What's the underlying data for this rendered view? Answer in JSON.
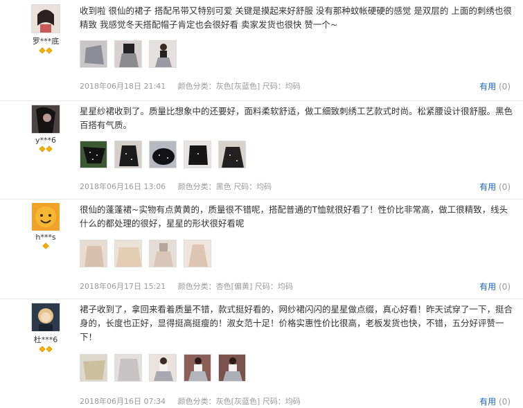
{
  "reviews": [
    {
      "user": "罗***底",
      "text": "收到啦 很仙的裙子 搭配吊带又特别可爱 关键是摸起来好舒服 没有那种蚊帐硬硬的感觉 是双层的 上面的刺绣也很精致 我感觉冬天搭配帽子肯定也会很好看 卖家发货也很快 赞一个~",
      "date": "2018年06月18日 21:41",
      "color_label": "颜色分类：",
      "color": "灰色[灰蓝色]",
      "size_label": "尺码：",
      "size": "均码",
      "useful_label": "有用",
      "useful_count": "(0)"
    },
    {
      "user": "y***6",
      "text": "星星纱裙收到了。质量比想象中的还要好，面料柔软舒适，做工细致刺绣工艺款式时尚。松紧腰设计很舒服。黑色百搭有气质。",
      "date": "2018年06月16日 13:06",
      "color_label": "颜色分类：",
      "color": "黑色",
      "size_label": "尺码：",
      "size": "均码",
      "useful_label": "有用",
      "useful_count": "(0)"
    },
    {
      "user": "h***s",
      "text": "很仙的蓬蓬裙~实物有点黄黄的，质量很不错呢，搭配普通的T恤就很好看了！性价比非常高，做工很精致，线头什么的都处理的很好，星星的形状很好看呢",
      "date": "2018年06月17日 15:21",
      "color_label": "颜色分类：",
      "color": "杏色[偏黄]",
      "size_label": "尺码：",
      "size": "均码",
      "useful_label": "有用",
      "useful_count": "(0)"
    },
    {
      "user": "杜***6",
      "text": "裙子收到了，拿回来看着质量不错，款式挺好看的，网纱裙闪闪的星星做点缀，真心好看！昨天试穿了一下，挺合身的，长度也正好，显得挺高挺瘦的！淑女范十足！价格实惠性价比很高，老板发货也快，不错，五分好评赞一下！",
      "date": "2018年06月16日 07:34",
      "color_label": "颜色分类：",
      "color": "灰色[灰蓝色]",
      "size_label": "尺码：",
      "size": "均码",
      "useful_label": "有用",
      "useful_count": "(0)"
    }
  ]
}
